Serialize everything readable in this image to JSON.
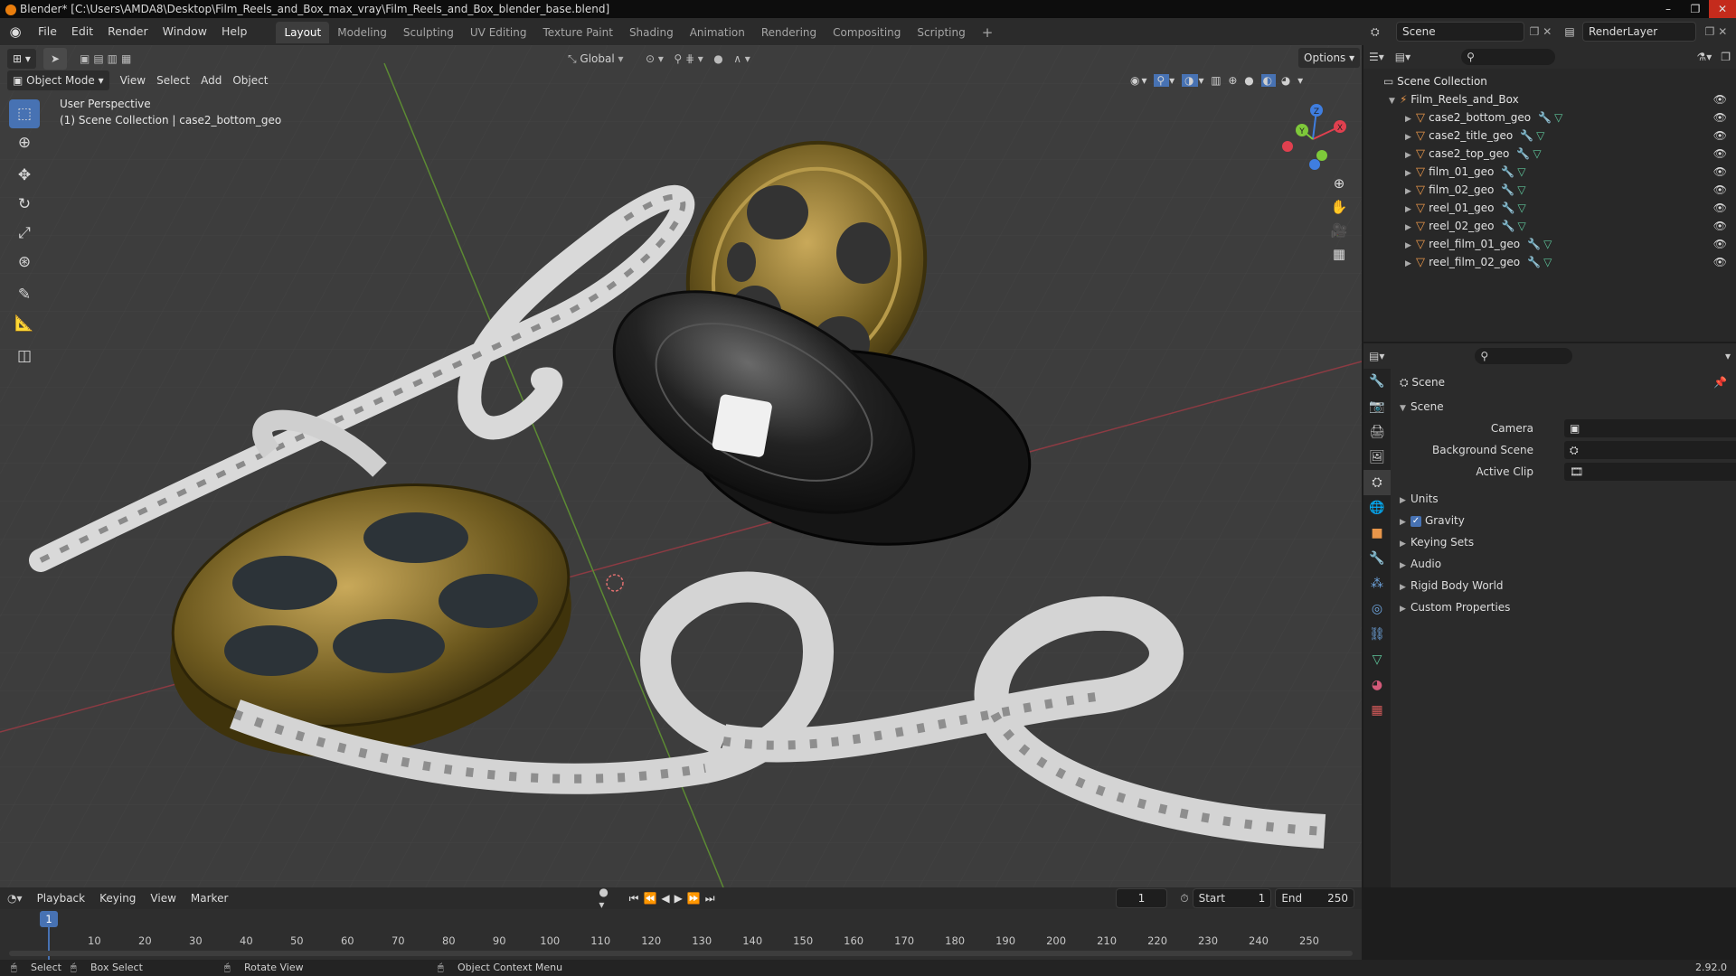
{
  "window": {
    "title": "Blender* [C:\\Users\\AMDA8\\Desktop\\Film_Reels_and_Box_max_vray\\Film_Reels_and_Box_blender_base.blend]"
  },
  "menu": [
    "File",
    "Edit",
    "Render",
    "Window",
    "Help"
  ],
  "workspaces": [
    "Layout",
    "Modeling",
    "Sculpting",
    "UV Editing",
    "Texture Paint",
    "Shading",
    "Animation",
    "Rendering",
    "Compositing",
    "Scripting"
  ],
  "top_right": {
    "scene": "Scene",
    "render_layer": "RenderLayer"
  },
  "viewport": {
    "mode": "Object Mode",
    "menus": [
      "View",
      "Select",
      "Add",
      "Object"
    ],
    "transform": "Global",
    "options": "Options",
    "overlay_title": "User Perspective",
    "overlay_sub": "(1) Scene Collection | case2_bottom_geo",
    "gizmo_axes": {
      "x": "X",
      "y": "Y",
      "z": "Z"
    }
  },
  "outliner": {
    "root": "Scene Collection",
    "collection": "Film_Reels_and_Box",
    "objects": [
      "case2_bottom_geo",
      "case2_title_geo",
      "case2_top_geo",
      "film_01_geo",
      "film_02_geo",
      "reel_01_geo",
      "reel_02_geo",
      "reel_film_01_geo",
      "reel_film_02_geo"
    ]
  },
  "properties": {
    "context": "Scene",
    "panel": "Scene",
    "fields": [
      {
        "label": "Camera"
      },
      {
        "label": "Background Scene"
      },
      {
        "label": "Active Clip"
      }
    ],
    "subpanels": [
      "Units",
      "Gravity",
      "Keying Sets",
      "Audio",
      "Rigid Body World",
      "Custom Properties"
    ]
  },
  "timeline": {
    "menus": [
      "Playback",
      "Keying",
      "View",
      "Marker"
    ],
    "current_frame": "1",
    "start_label": "Start",
    "start": "1",
    "end_label": "End",
    "end": "250",
    "ticks": [
      "1",
      "10",
      "20",
      "30",
      "40",
      "50",
      "60",
      "70",
      "80",
      "90",
      "100",
      "110",
      "120",
      "130",
      "140",
      "150",
      "160",
      "170",
      "180",
      "190",
      "200",
      "210",
      "220",
      "230",
      "240",
      "250"
    ]
  },
  "statusbar": {
    "select": "Select",
    "box_select": "Box Select",
    "rotate_view": "Rotate View",
    "context_menu": "Object Context Menu",
    "version": "2.92.0"
  },
  "colors": {
    "accent": "#4772b3",
    "brand": "#e87d0d",
    "x_axis": "#e0404f",
    "y_axis": "#7ec93a",
    "z_axis": "#3f7ee0"
  }
}
